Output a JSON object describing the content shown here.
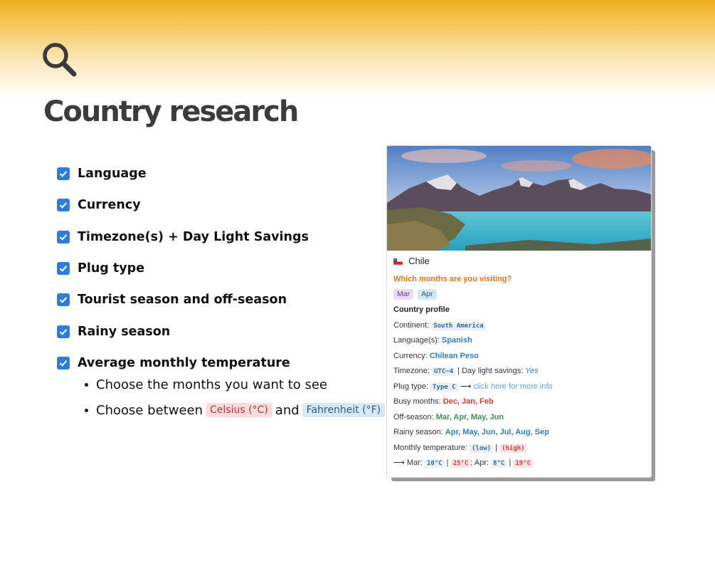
{
  "header": {
    "title": "Country research"
  },
  "checklist": [
    {
      "label": "Language",
      "checked": true
    },
    {
      "label": "Currency",
      "checked": true
    },
    {
      "label": "Timezone(s) + Day Light Savings",
      "checked": true
    },
    {
      "label": "Plug type",
      "checked": true
    },
    {
      "label": "Tourist season and off-season",
      "checked": true
    },
    {
      "label": "Rainy season",
      "checked": true
    },
    {
      "label": "Average monthly temperature",
      "checked": true
    }
  ],
  "sub_bullets": {
    "months": "Choose the months you want to see",
    "choose_prefix": "Choose between",
    "celsius": "Celsius (°C)",
    "and": "and",
    "fahrenheit": "Fahrenheit (°F)"
  },
  "card": {
    "country": "Chile",
    "question": "Which months are you visiting?",
    "months": [
      "Mar",
      "Apr"
    ],
    "section_title": "Country profile",
    "continent_label": "Continent:",
    "continent": "South America",
    "language_label": "Language(s):",
    "language": "Spanish",
    "currency_label": "Currency:",
    "currency": "Chilean Peso",
    "timezone_label": "Timezone:",
    "timezone": "UTC−4",
    "dls_sep": "| Day light savings:",
    "dls": "Yes",
    "plug_label": "Plug type:",
    "plug": "Type C",
    "arrow": "⟶",
    "plug_link": "click here for more info",
    "busy_label": "Busy months:",
    "busy": "Dec, Jan, Feb",
    "off_label": "Off-season:",
    "off": "Mar, Apr, May, Jun",
    "rainy_label": "Rainy season:",
    "rainy": "Apr, May, Jun, Jul, Aug, Sep",
    "temp_label": "Monthly temperature:",
    "low": "(low)",
    "pipe": "|",
    "high": "(high)",
    "mar_label": "Mar:",
    "mar_low": "10°C",
    "mar_high": "25°C",
    "apr_label": "; Apr:",
    "apr_low": "8°C",
    "apr_high": "19°C"
  },
  "colors": {
    "accent_blue": "#2f7cd6",
    "banner_gold": "#efb020"
  },
  "icons": {
    "header": "search-icon",
    "checkbox": "checkmark-icon",
    "card_flag": "chile-flag-icon",
    "card_image": "patagonia-landscape-image"
  }
}
